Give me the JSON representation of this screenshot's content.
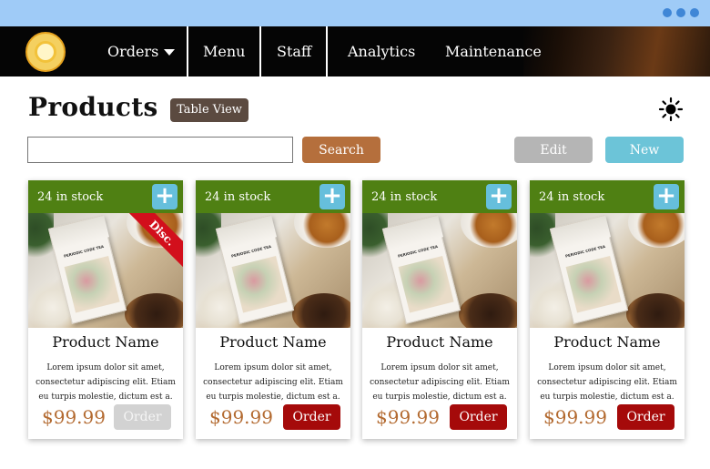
{
  "nav": {
    "items": [
      {
        "label": "Orders",
        "has_dropdown": true
      },
      {
        "label": "Menu"
      },
      {
        "label": "Staff"
      },
      {
        "label": "Analytics"
      },
      {
        "label": "Maintenance"
      }
    ]
  },
  "header": {
    "title": "Products",
    "view_toggle": "Table View",
    "theme_icon": "sun-icon"
  },
  "search": {
    "value": "",
    "placeholder": "",
    "button_label": "Search"
  },
  "actions": {
    "edit_label": "Edit",
    "new_label": "New"
  },
  "products": [
    {
      "stock": "24 in stock",
      "name": "Product Name",
      "description": "Lorem ipsum dolor sit amet, consectetur adipiscing elit. Etiam eu turpis molestie, dictum est a.",
      "price": "$99.99",
      "order_label": "Order",
      "order_enabled": false,
      "badge": "Disc."
    },
    {
      "stock": "24 in stock",
      "name": "Product Name",
      "description": "Lorem ipsum dolor sit amet, consectetur adipiscing elit. Etiam eu turpis molestie, dictum est a.",
      "price": "$99.99",
      "order_label": "Order",
      "order_enabled": true
    },
    {
      "stock": "24 in stock",
      "name": "Product Name",
      "description": "Lorem ipsum dolor sit amet, consectetur adipiscing elit. Etiam eu turpis molestie, dictum est a.",
      "price": "$99.99",
      "order_label": "Order",
      "order_enabled": true
    },
    {
      "stock": "24 in stock",
      "name": "Product Name",
      "description": "Lorem ipsum dolor sit amet, consectetur adipiscing elit. Etiam eu turpis molestie, dictum est a.",
      "price": "$99.99",
      "order_label": "Order",
      "order_enabled": true
    }
  ],
  "packaging_text": "PERIODIC CODE TEA",
  "colors": {
    "stock_bar": "#4f8013",
    "add_button": "#66bfdc",
    "order_enabled": "#a50a0a",
    "order_disabled": "#d2d2d2",
    "price": "#b36a30",
    "search_button": "#b56f3c",
    "edit_button": "#b5b5b5",
    "new_button": "#6cc4d8",
    "discount_ribbon": "#d20f1c"
  }
}
